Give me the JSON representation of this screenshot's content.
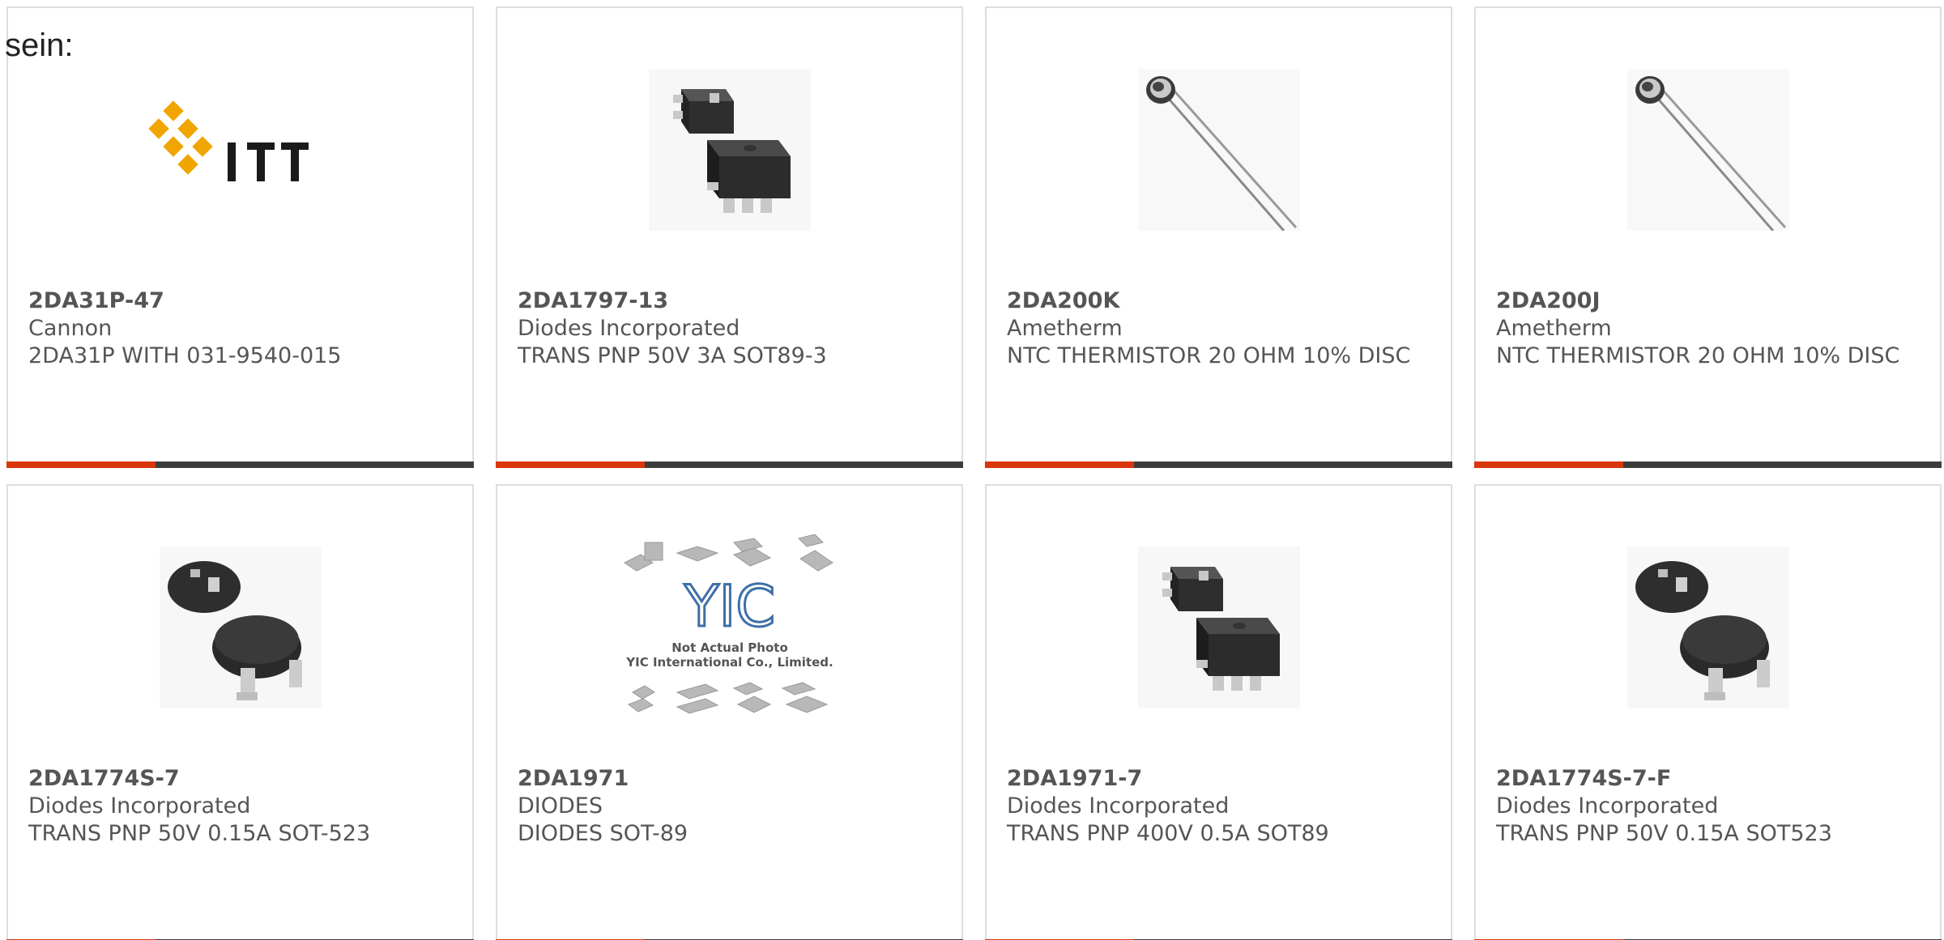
{
  "page": {
    "prefix_text": "sein:"
  },
  "colors": {
    "accent": "#d9360b",
    "bar_dark": "#3c3c3c",
    "border": "#dddddd",
    "text": "#555555"
  },
  "products": [
    {
      "part_number": "2DA31P-47",
      "manufacturer": "Cannon",
      "description": "2DA31P WITH 031-9540-015",
      "image": "itt-logo",
      "logo_text": "ITT"
    },
    {
      "part_number": "2DA1797-13",
      "manufacturer": "Diodes Incorporated",
      "description": "TRANS PNP 50V 3A SOT89-3",
      "image": "sot89-package-photo"
    },
    {
      "part_number": "2DA200K",
      "manufacturer": "Ametherm",
      "description": "NTC THERMISTOR 20 OHM 10% DISC",
      "image": "disc-thermistor-photo"
    },
    {
      "part_number": "2DA200J",
      "manufacturer": "Ametherm",
      "description": "NTC THERMISTOR 20 OHM 10% DISC",
      "image": "disc-thermistor-photo"
    },
    {
      "part_number": "2DA1774S-7",
      "manufacturer": "Diodes Incorporated",
      "description": "TRANS PNP 50V 0.15A SOT-523",
      "image": "sot523-package-photo"
    },
    {
      "part_number": "2DA1971",
      "manufacturer": "DIODES",
      "description": "DIODES SOT-89",
      "image": "yic-placeholder",
      "placeholder_logo": "YIC",
      "placeholder_line1": "Not Actual Photo",
      "placeholder_line2": "YIC International Co., Limited."
    },
    {
      "part_number": "2DA1971-7",
      "manufacturer": "Diodes Incorporated",
      "description": "TRANS PNP 400V 0.5A SOT89",
      "image": "sot89-package-photo"
    },
    {
      "part_number": "2DA1774S-7-F",
      "manufacturer": "Diodes Incorporated",
      "description": "TRANS PNP 50V 0.15A SOT523",
      "image": "sot523-package-photo"
    }
  ]
}
